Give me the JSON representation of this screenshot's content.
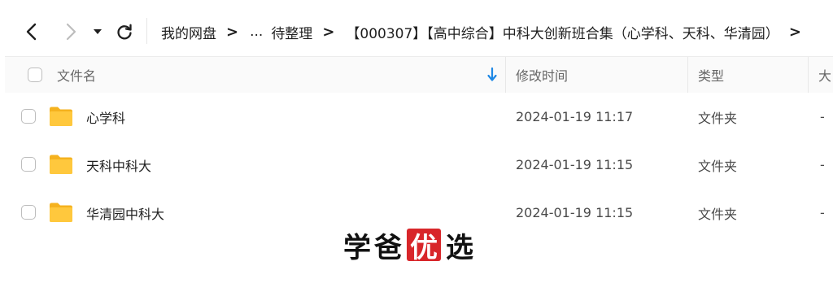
{
  "breadcrumb": {
    "root": "我的网盘",
    "ellipsis": "...",
    "items": [
      "待整理",
      "【000307】【高中综合】中科大创新班合集（心学科、天科、华清园）"
    ]
  },
  "icons": {
    "back": "chevron-left-icon",
    "forward": "chevron-right-icon",
    "dropdown": "caret-down-icon",
    "refresh": "refresh-icon",
    "sort": "sort-down-arrow-icon",
    "folder": "folder-icon"
  },
  "colors": {
    "folder": "#FFC83D",
    "sort_arrow": "#1E88E5",
    "watermark_accent": "#D8262A"
  },
  "columns": {
    "name": "文件名",
    "modified": "修改时间",
    "type": "类型",
    "size": "大"
  },
  "rows": [
    {
      "name": "心学科",
      "modified": "2024-01-19 11:17",
      "type": "文件夹",
      "size": "-"
    },
    {
      "name": "天科中科大",
      "modified": "2024-01-19 11:15",
      "type": "文件夹",
      "size": "-"
    },
    {
      "name": "华清园中科大",
      "modified": "2024-01-19 11:15",
      "type": "文件夹",
      "size": "-"
    }
  ],
  "watermark": {
    "part1": "学爸",
    "accent": "优",
    "part2": "选"
  }
}
